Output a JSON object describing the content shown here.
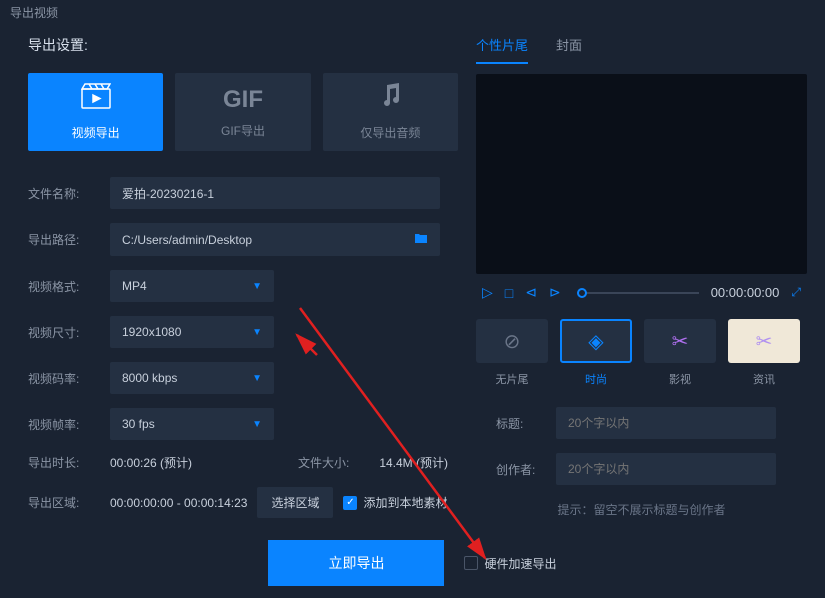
{
  "window_title": "导出视频",
  "left_title": "导出设置:",
  "modes": {
    "video": "视频导出",
    "gif": "GIF导出",
    "audio": "仅导出音频",
    "gif_text": "GIF"
  },
  "labels": {
    "filename": "文件名称:",
    "path": "导出路径:",
    "format": "视频格式:",
    "size": "视频尺寸:",
    "bitrate": "视频码率:",
    "fps": "视频帧率:",
    "duration": "导出时长:",
    "filesize": "文件大小:",
    "region": "导出区域:"
  },
  "values": {
    "filename": "爱拍-20230216-1",
    "path": "C:/Users/admin/Desktop",
    "format": "MP4",
    "size": "1920x1080",
    "bitrate": "8000 kbps",
    "fps": "30 fps",
    "duration": "00:00:26 (预计)",
    "filesize": "14.4M (预计)",
    "region": "00:00:00:00 - 00:00:14:23"
  },
  "buttons": {
    "select_region": "选择区域",
    "export": "立即导出"
  },
  "checkboxes": {
    "add_local": "添加到本地素材",
    "hw_accel": "硬件加速导出"
  },
  "right_tabs": {
    "trailer": "个性片尾",
    "cover": "封面"
  },
  "player": {
    "time": "00:00:00:00"
  },
  "trailers": {
    "none": "无片尾",
    "fashion": "时尚",
    "movie": "影视",
    "news": "资讯"
  },
  "right_labels": {
    "title": "标题:",
    "creator": "创作者:"
  },
  "right_placeholders": {
    "title": "20个字以内",
    "creator": "20个字以内"
  },
  "hint": "提示：留空不展示标题与创作者"
}
